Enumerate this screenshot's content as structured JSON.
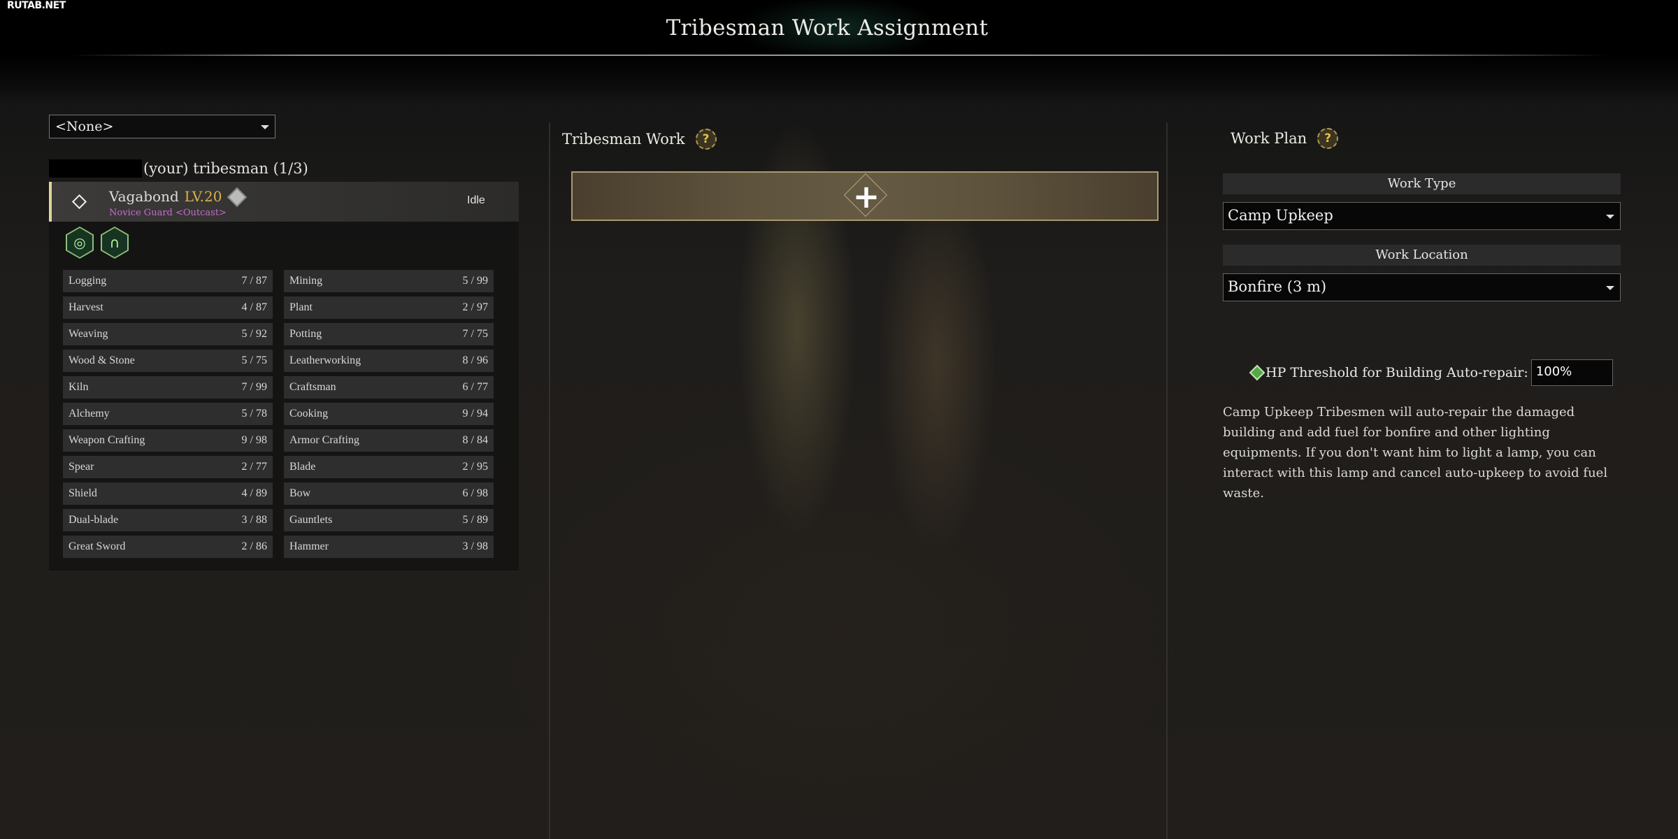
{
  "watermark": "RUTAB.NET",
  "title": "Tribesman Work Assignment",
  "left": {
    "filter": {
      "selected": "<None>"
    },
    "tribe_header": "(your) tribesman (1/3)",
    "member": {
      "name": "Vagabond",
      "level": "LV.20",
      "role": "Novice Guard <Outcast>",
      "status": "Idle",
      "traits": [
        {
          "icon": "target-trait-icon",
          "glyph": "◎"
        },
        {
          "icon": "arch-trait-icon",
          "glyph": "∩"
        }
      ]
    },
    "skills": [
      {
        "name": "Logging",
        "value": "7 / 87"
      },
      {
        "name": "Mining",
        "value": "5 / 99"
      },
      {
        "name": "Harvest",
        "value": "4 / 87"
      },
      {
        "name": "Plant",
        "value": "2 / 97"
      },
      {
        "name": "Weaving",
        "value": "5 / 92"
      },
      {
        "name": "Potting",
        "value": "7 / 75"
      },
      {
        "name": "Wood & Stone",
        "value": "5 / 75"
      },
      {
        "name": "Leatherworking",
        "value": "8 / 96"
      },
      {
        "name": "Kiln",
        "value": "7 / 99"
      },
      {
        "name": "Craftsman",
        "value": "6 / 77"
      },
      {
        "name": "Alchemy",
        "value": "5 / 78"
      },
      {
        "name": "Cooking",
        "value": "9 / 94"
      },
      {
        "name": "Weapon Crafting",
        "value": "9 / 98"
      },
      {
        "name": "Armor Crafting",
        "value": "8 / 84"
      },
      {
        "name": "Spear",
        "value": "2 / 77"
      },
      {
        "name": "Blade",
        "value": "2 / 95"
      },
      {
        "name": "Shield",
        "value": "4 / 89"
      },
      {
        "name": "Bow",
        "value": "6 / 98"
      },
      {
        "name": "Dual-blade",
        "value": "3 / 88"
      },
      {
        "name": "Gauntlets",
        "value": "5 / 89"
      },
      {
        "name": "Great Sword",
        "value": "2 / 86"
      },
      {
        "name": "Hammer",
        "value": "3 / 98"
      }
    ]
  },
  "middle": {
    "title": "Tribesman Work",
    "help": "?",
    "add_glyph": "+"
  },
  "right": {
    "title": "Work Plan",
    "help": "?",
    "work_type_label": "Work Type",
    "work_type_value": "Camp Upkeep",
    "work_location_label": "Work Location",
    "work_location_value": "Bonfire (3 m)",
    "threshold_label": "HP Threshold for Building Auto-repair:",
    "threshold_value": "100%",
    "description": "Camp Upkeep Tribesmen will auto-repair the damaged building and add fuel for bonfire and other lighting equipments. If you don't want him to light a lamp, you can interact with this lamp and cancel auto-upkeep to avoid fuel waste."
  }
}
